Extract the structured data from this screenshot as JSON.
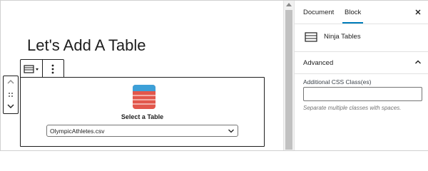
{
  "editor": {
    "title": "Let's Add A Table"
  },
  "block": {
    "heading": "Select a Table",
    "select_value": "OlympicAthletes.csv"
  },
  "sidebar": {
    "tabs": [
      {
        "label": "Document"
      },
      {
        "label": "Block"
      }
    ],
    "close_icon": "close-icon",
    "block_card_name": "Ninja Tables",
    "panel_title": "Advanced",
    "field_label": "Additional CSS Class(es)",
    "field_value": "",
    "field_help": "Separate multiple classes with spaces."
  },
  "colors": {
    "accent": "#007cba",
    "table_icon_red": "#e2574c",
    "border_dark": "#1e1e1e"
  }
}
